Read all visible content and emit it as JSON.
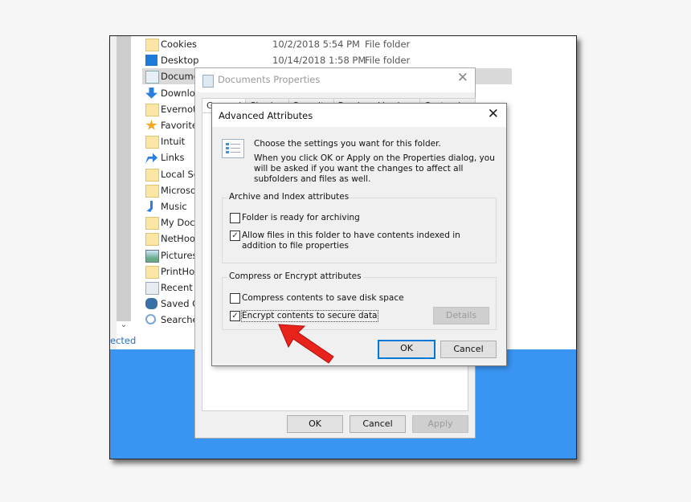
{
  "explorer": {
    "items": [
      {
        "name": "Cookies",
        "icon": "shortcut-folder-icon",
        "date": "10/2/2018 5:54 PM",
        "type": "File folder"
      },
      {
        "name": "Desktop",
        "icon": "desktop-icon",
        "date": "10/14/2018 1:58 PM",
        "type": "File folder"
      },
      {
        "name": "Documents",
        "icon": "documents-icon",
        "selected": true
      },
      {
        "name": "Downloads",
        "icon": "downloads-icon"
      },
      {
        "name": "Evernote",
        "icon": "folder-icon"
      },
      {
        "name": "Favorites",
        "icon": "star-icon"
      },
      {
        "name": "Intuit",
        "icon": "folder-icon"
      },
      {
        "name": "Links",
        "icon": "links-icon"
      },
      {
        "name": "Local Settings",
        "icon": "shortcut-folder-icon"
      },
      {
        "name": "Microsoft",
        "icon": "folder-icon"
      },
      {
        "name": "Music",
        "icon": "music-icon"
      },
      {
        "name": "My Documents",
        "icon": "shortcut-folder-icon"
      },
      {
        "name": "NetHood",
        "icon": "shortcut-folder-icon"
      },
      {
        "name": "Pictures",
        "icon": "pictures-icon"
      },
      {
        "name": "PrintHood",
        "icon": "shortcut-folder-icon"
      },
      {
        "name": "Recent",
        "icon": "recent-icon"
      },
      {
        "name": "Saved Games",
        "icon": "saved-games-icon"
      },
      {
        "name": "Searches",
        "icon": "search-icon"
      }
    ],
    "status": "ected"
  },
  "properties_dialog": {
    "title": "Documents Properties",
    "tabs": [
      "General",
      "Sharing",
      "Security",
      "Previous Versions",
      "Customize"
    ],
    "buttons": {
      "ok": "OK",
      "cancel": "Cancel",
      "apply": "Apply"
    }
  },
  "advanced_dialog": {
    "title": "Advanced Attributes",
    "intro": "Choose the settings you want for this folder.",
    "description": "When you click OK or Apply on the Properties dialog, you will be asked if you want the changes to affect all subfolders and files as well.",
    "archive_group": {
      "title": "Archive and Index attributes",
      "options": [
        {
          "label": "Folder is ready for archiving",
          "checked": false
        },
        {
          "label": "Allow files in this folder to have contents indexed in addition to file properties",
          "checked": true
        }
      ]
    },
    "compress_group": {
      "title": "Compress or Encrypt attributes",
      "options": [
        {
          "label": "Compress contents to save disk space",
          "checked": false
        },
        {
          "label": "Encrypt contents to secure data",
          "checked": true
        }
      ],
      "details_button": "Details"
    },
    "buttons": {
      "ok": "OK",
      "cancel": "Cancel"
    }
  },
  "annotation": {
    "arrow_color": "#e8231b"
  },
  "colors": {
    "desktop_blue": "#3a94f2",
    "accent": "#0078d7"
  }
}
